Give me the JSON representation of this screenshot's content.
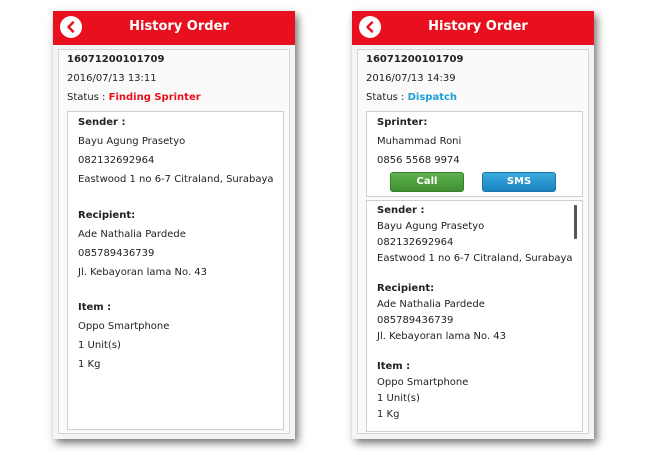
{
  "screens": [
    {
      "header": {
        "title": "History Order",
        "back_icon": "back-arrow-icon"
      },
      "order": {
        "id": "16071200101709",
        "datetime": "2016/07/13 13:11",
        "status_label": "Status :",
        "status_value": "Finding Sprinter",
        "status_color": "#e8101e"
      },
      "details": {
        "sender_label": "Sender :",
        "sender_name": "Bayu Agung Prasetyo",
        "sender_phone": "082132692964",
        "sender_address": "Eastwood 1 no 6-7 Citraland, Surabaya",
        "recipient_label": "Recipient:",
        "recipient_name": "Ade Nathalia Pardede",
        "recipient_phone": "085789436739",
        "recipient_address": "Jl. Kebayoran lama No. 43",
        "item_label": "Item :",
        "item_name": "Oppo Smartphone",
        "item_qty": "1 Unit(s)",
        "item_weight": "1 Kg"
      }
    },
    {
      "header": {
        "title": "History Order",
        "back_icon": "back-arrow-icon"
      },
      "order": {
        "id": "16071200101709",
        "datetime": "2016/07/13 14:39",
        "status_label": "Status :",
        "status_value": "Dispatch",
        "status_color": "#1ba0d8"
      },
      "sprinter": {
        "label": "Sprinter:",
        "name": "Muhammad Roni",
        "phone": "0856 5568 9974",
        "call_label": "Call",
        "sms_label": "SMS"
      },
      "details": {
        "sender_label": "Sender :",
        "sender_name": "Bayu Agung Prasetyo",
        "sender_phone": "082132692964",
        "sender_address": "Eastwood 1 no 6-7 Citraland, Surabaya",
        "recipient_label": "Recipient:",
        "recipient_name": "Ade Nathalia Pardede",
        "recipient_phone": "085789436739",
        "recipient_address": "Jl. Kebayoran lama No. 43",
        "item_label": "Item :",
        "item_name": "Oppo Smartphone",
        "item_qty": "1 Unit(s)",
        "item_weight": "1 Kg"
      }
    }
  ]
}
